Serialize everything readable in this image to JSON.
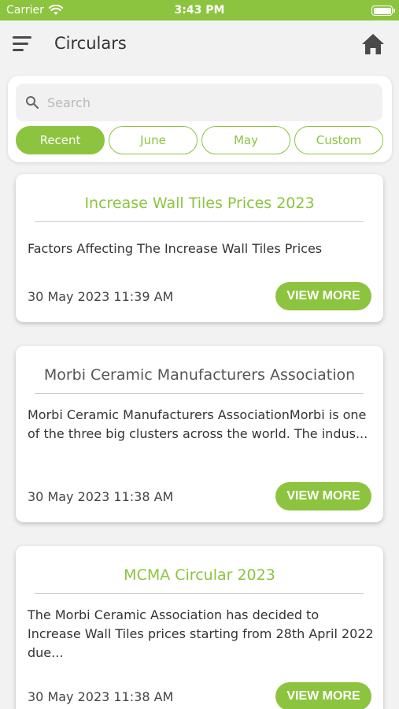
{
  "status_bar": {
    "carrier": "Carrier",
    "time": "3:43 PM"
  },
  "header": {
    "title": "Circulars"
  },
  "search": {
    "placeholder": "Search"
  },
  "filters": [
    {
      "label": "Recent",
      "active": true
    },
    {
      "label": "June",
      "active": false
    },
    {
      "label": "May",
      "active": false
    },
    {
      "label": "Custom",
      "active": false
    }
  ],
  "colors": {
    "accent": "#8cc43f",
    "background": "#f2f2f2",
    "card_title_dark": "#555555"
  },
  "circulars": [
    {
      "title": "Increase Wall Tiles Prices  2023",
      "title_color": "#8cc43f",
      "description": "Factors Affecting The Increase Wall Tiles Prices",
      "date": "30 May 2023 11:39 AM",
      "button_label": "VIEW MORE"
    },
    {
      "title": "Morbi Ceramic Manufacturers Association",
      "title_color": "#555555",
      "description": "Morbi Ceramic Manufacturers AssociationMorbi is one of the three big clusters across the world. The indus...",
      "date": "30 May 2023 11:38 AM",
      "button_label": "VIEW MORE"
    },
    {
      "title": "MCMA Circular 2023",
      "title_color": "#8cc43f",
      "description": "The Morbi Ceramic Association has decided to Increase Wall Tiles prices starting from 28th April 2022 due...",
      "date": "30 May 2023 11:38 AM",
      "button_label": "VIEW MORE"
    }
  ]
}
